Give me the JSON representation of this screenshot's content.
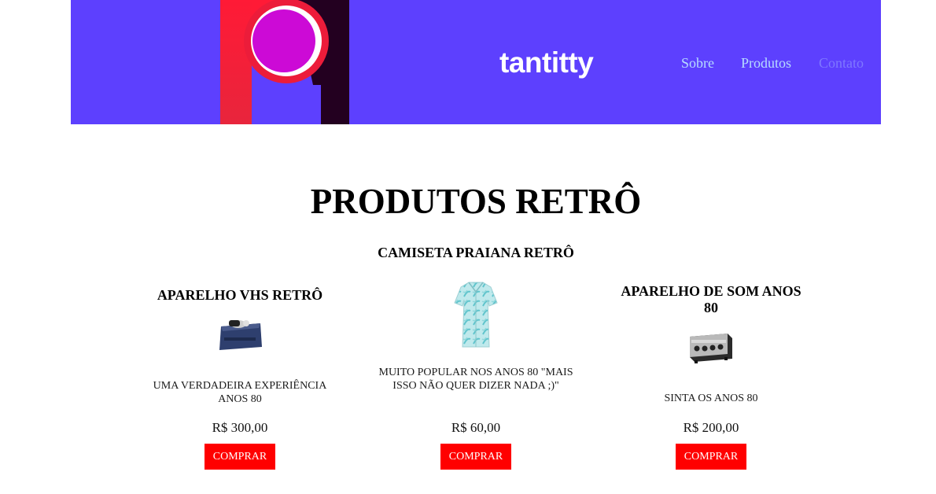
{
  "header": {
    "brand": "tantitty",
    "nav": [
      {
        "label": "Sobre"
      },
      {
        "label": "Produtos"
      },
      {
        "label": "Contato"
      }
    ]
  },
  "main": {
    "title": "PRODUTOS RETRÔ",
    "products": [
      {
        "name": "APARELHO VHS RETRÔ",
        "image_icon": "vhs-player-icon",
        "description": "UMA VERDADEIRA EXPERIÊNCIA ANOS 80",
        "price": "R$ 300,00",
        "button": "COMPRAR"
      },
      {
        "name": "CAMISETA PRAIANA RETRÔ",
        "image_icon": "beach-shirt-icon",
        "description": "MUITO POPULAR NOS ANOS 80 \"MAIS ISSO NÃO QUER DIZER NADA ;)\"",
        "price": "R$ 60,00",
        "button": "COMPRAR"
      },
      {
        "name": "APARELHO DE SOM ANOS 80",
        "image_icon": "stereo-amplifier-icon",
        "description": "SINTA OS ANOS 80",
        "price": "R$ 200,00",
        "button": "COMPRAR"
      }
    ]
  },
  "colors": {
    "header_bg": "#5d40fe",
    "button_bg": "#ff0000",
    "nav_link": "#b7dcff",
    "nav_link_dim": "#7f78ff"
  }
}
